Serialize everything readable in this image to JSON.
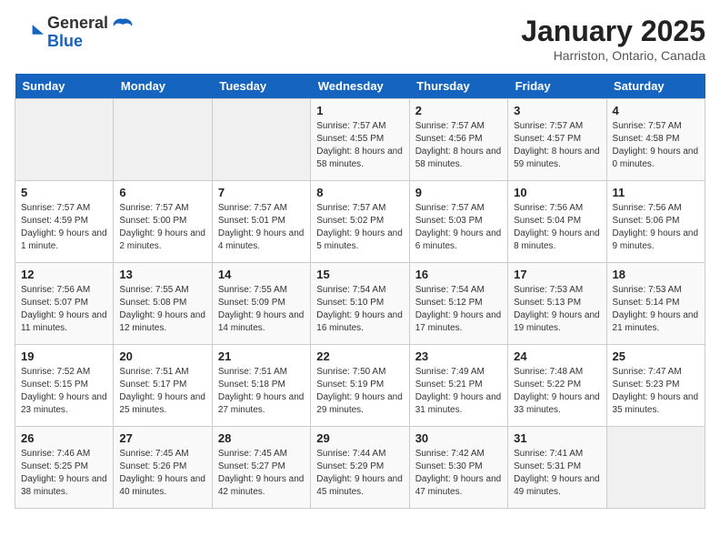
{
  "header": {
    "logo_line1": "General",
    "logo_line2": "Blue",
    "title": "January 2025",
    "subtitle": "Harriston, Ontario, Canada"
  },
  "weekdays": [
    "Sunday",
    "Monday",
    "Tuesday",
    "Wednesday",
    "Thursday",
    "Friday",
    "Saturday"
  ],
  "weeks": [
    [
      {
        "day": "",
        "empty": true
      },
      {
        "day": "",
        "empty": true
      },
      {
        "day": "",
        "empty": true
      },
      {
        "day": "1",
        "sunrise": "7:57 AM",
        "sunset": "4:55 PM",
        "daylight": "8 hours and 58 minutes."
      },
      {
        "day": "2",
        "sunrise": "7:57 AM",
        "sunset": "4:56 PM",
        "daylight": "8 hours and 58 minutes."
      },
      {
        "day": "3",
        "sunrise": "7:57 AM",
        "sunset": "4:57 PM",
        "daylight": "8 hours and 59 minutes."
      },
      {
        "day": "4",
        "sunrise": "7:57 AM",
        "sunset": "4:58 PM",
        "daylight": "9 hours and 0 minutes."
      }
    ],
    [
      {
        "day": "5",
        "sunrise": "7:57 AM",
        "sunset": "4:59 PM",
        "daylight": "9 hours and 1 minute."
      },
      {
        "day": "6",
        "sunrise": "7:57 AM",
        "sunset": "5:00 PM",
        "daylight": "9 hours and 2 minutes."
      },
      {
        "day": "7",
        "sunrise": "7:57 AM",
        "sunset": "5:01 PM",
        "daylight": "9 hours and 4 minutes."
      },
      {
        "day": "8",
        "sunrise": "7:57 AM",
        "sunset": "5:02 PM",
        "daylight": "9 hours and 5 minutes."
      },
      {
        "day": "9",
        "sunrise": "7:57 AM",
        "sunset": "5:03 PM",
        "daylight": "9 hours and 6 minutes."
      },
      {
        "day": "10",
        "sunrise": "7:56 AM",
        "sunset": "5:04 PM",
        "daylight": "9 hours and 8 minutes."
      },
      {
        "day": "11",
        "sunrise": "7:56 AM",
        "sunset": "5:06 PM",
        "daylight": "9 hours and 9 minutes."
      }
    ],
    [
      {
        "day": "12",
        "sunrise": "7:56 AM",
        "sunset": "5:07 PM",
        "daylight": "9 hours and 11 minutes."
      },
      {
        "day": "13",
        "sunrise": "7:55 AM",
        "sunset": "5:08 PM",
        "daylight": "9 hours and 12 minutes."
      },
      {
        "day": "14",
        "sunrise": "7:55 AM",
        "sunset": "5:09 PM",
        "daylight": "9 hours and 14 minutes."
      },
      {
        "day": "15",
        "sunrise": "7:54 AM",
        "sunset": "5:10 PM",
        "daylight": "9 hours and 16 minutes."
      },
      {
        "day": "16",
        "sunrise": "7:54 AM",
        "sunset": "5:12 PM",
        "daylight": "9 hours and 17 minutes."
      },
      {
        "day": "17",
        "sunrise": "7:53 AM",
        "sunset": "5:13 PM",
        "daylight": "9 hours and 19 minutes."
      },
      {
        "day": "18",
        "sunrise": "7:53 AM",
        "sunset": "5:14 PM",
        "daylight": "9 hours and 21 minutes."
      }
    ],
    [
      {
        "day": "19",
        "sunrise": "7:52 AM",
        "sunset": "5:15 PM",
        "daylight": "9 hours and 23 minutes."
      },
      {
        "day": "20",
        "sunrise": "7:51 AM",
        "sunset": "5:17 PM",
        "daylight": "9 hours and 25 minutes."
      },
      {
        "day": "21",
        "sunrise": "7:51 AM",
        "sunset": "5:18 PM",
        "daylight": "9 hours and 27 minutes."
      },
      {
        "day": "22",
        "sunrise": "7:50 AM",
        "sunset": "5:19 PM",
        "daylight": "9 hours and 29 minutes."
      },
      {
        "day": "23",
        "sunrise": "7:49 AM",
        "sunset": "5:21 PM",
        "daylight": "9 hours and 31 minutes."
      },
      {
        "day": "24",
        "sunrise": "7:48 AM",
        "sunset": "5:22 PM",
        "daylight": "9 hours and 33 minutes."
      },
      {
        "day": "25",
        "sunrise": "7:47 AM",
        "sunset": "5:23 PM",
        "daylight": "9 hours and 35 minutes."
      }
    ],
    [
      {
        "day": "26",
        "sunrise": "7:46 AM",
        "sunset": "5:25 PM",
        "daylight": "9 hours and 38 minutes."
      },
      {
        "day": "27",
        "sunrise": "7:45 AM",
        "sunset": "5:26 PM",
        "daylight": "9 hours and 40 minutes."
      },
      {
        "day": "28",
        "sunrise": "7:45 AM",
        "sunset": "5:27 PM",
        "daylight": "9 hours and 42 minutes."
      },
      {
        "day": "29",
        "sunrise": "7:44 AM",
        "sunset": "5:29 PM",
        "daylight": "9 hours and 45 minutes."
      },
      {
        "day": "30",
        "sunrise": "7:42 AM",
        "sunset": "5:30 PM",
        "daylight": "9 hours and 47 minutes."
      },
      {
        "day": "31",
        "sunrise": "7:41 AM",
        "sunset": "5:31 PM",
        "daylight": "9 hours and 49 minutes."
      },
      {
        "day": "",
        "empty": true
      }
    ]
  ],
  "labels": {
    "sunrise_prefix": "Sunrise: ",
    "sunset_prefix": "Sunset: ",
    "daylight_prefix": "Daylight: "
  }
}
